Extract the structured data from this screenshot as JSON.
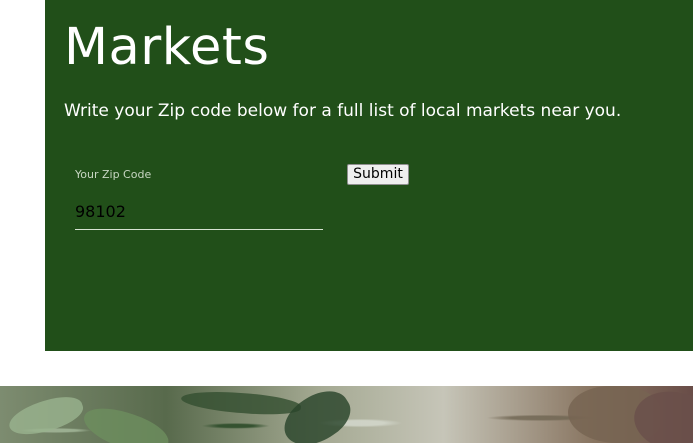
{
  "market_section": {
    "title": "Markets",
    "intro": "Write your Zip code below for a full list of local markets near you.",
    "zip_label": "Your Zip Code",
    "zip_value": "98102",
    "submit_label": "Submit"
  },
  "theme": {
    "panel_color": "#214f19",
    "text_color": "#ffffff",
    "button_color": "#efefef"
  },
  "images": {
    "hero_image": "vegetables-photo"
  }
}
